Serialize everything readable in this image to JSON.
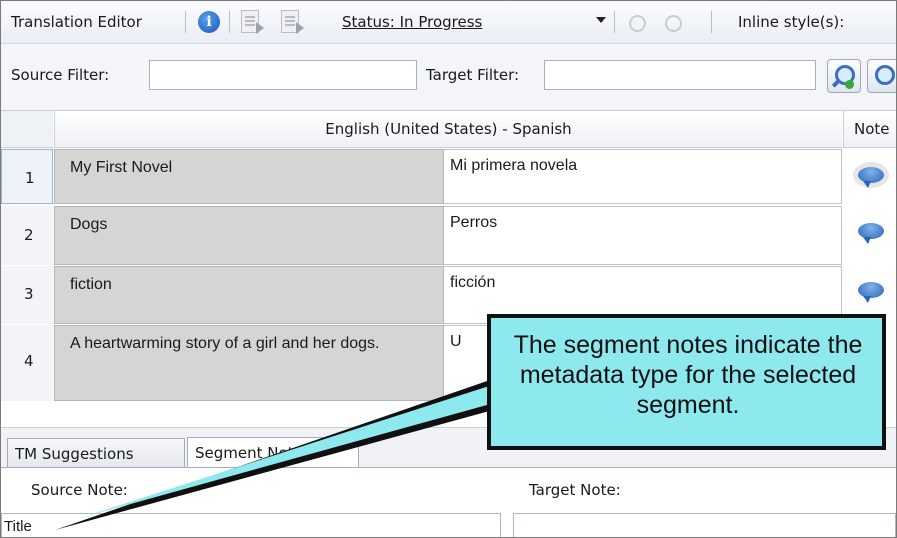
{
  "toolbar": {
    "title": "Translation Editor",
    "status_label": "Status: In Progress",
    "inline_style_label": "Inline style(s):"
  },
  "filters": {
    "source_label": "Source Filter:",
    "source_value": "",
    "target_label": "Target Filter:",
    "target_value": ""
  },
  "grid": {
    "language_pair": "English (United States) - Spanish",
    "notes_header": "Note",
    "rows": [
      {
        "num": "1",
        "source": "My First Novel",
        "target": "Mi primera novela"
      },
      {
        "num": "2",
        "source": "Dogs",
        "target": "Perros"
      },
      {
        "num": "3",
        "source": "fiction",
        "target": "ficción"
      },
      {
        "num": "4",
        "source": "A heartwarming story of a girl and her dogs.",
        "target": "U"
      }
    ]
  },
  "tabs": [
    {
      "label": "TM Suggestions",
      "active": false
    },
    {
      "label": "Segment Notes",
      "active": true
    }
  ],
  "notes": {
    "source_label": "Source Note:",
    "source_value": "Title",
    "target_label": "Target Note:",
    "target_value": ""
  },
  "callout": {
    "text": "The segment notes indicate the metadata type for the selected segment.",
    "fill_color": "#8ee9ee",
    "border_color": "#1f1f1f"
  },
  "colors": {
    "info_icon": "#1459b8",
    "note_icon": "#2a64b8",
    "source_cell": "#d5d5d5"
  }
}
